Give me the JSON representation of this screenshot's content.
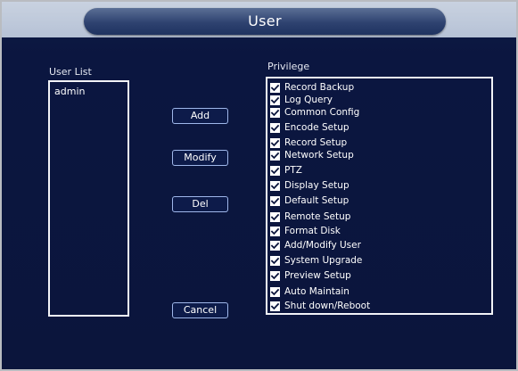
{
  "window": {
    "title": "User"
  },
  "user_list": {
    "label": "User List",
    "items": [
      "admin"
    ]
  },
  "buttons": {
    "add": "Add",
    "modify": "Modify",
    "del": "Del",
    "cancel": "Cancel"
  },
  "privilege": {
    "label": "Privilege",
    "items": [
      {
        "label": "Record Backup",
        "checked": true
      },
      {
        "label": "Log Query",
        "checked": true
      },
      {
        "label": "Common Config",
        "checked": true
      },
      {
        "label": "Encode Setup",
        "checked": true
      },
      {
        "label": "Record Setup",
        "checked": true
      },
      {
        "label": "Network Setup",
        "checked": true
      },
      {
        "label": "PTZ",
        "checked": true
      },
      {
        "label": "Display Setup",
        "checked": true
      },
      {
        "label": "Default Setup",
        "checked": true
      },
      {
        "label": "Remote Setup",
        "checked": true
      },
      {
        "label": "Format Disk",
        "checked": true
      },
      {
        "label": "Add/Modify User",
        "checked": true
      },
      {
        "label": "System Upgrade",
        "checked": true
      },
      {
        "label": "Preview Setup",
        "checked": true
      },
      {
        "label": "Auto Maintain",
        "checked": true
      },
      {
        "label": "Shut down/Reboot",
        "checked": true
      }
    ]
  },
  "colors": {
    "background": "#0b153c",
    "title_pill": "#2e4270",
    "border": "#f2f3f7",
    "button_border": "#9fb7ea"
  }
}
